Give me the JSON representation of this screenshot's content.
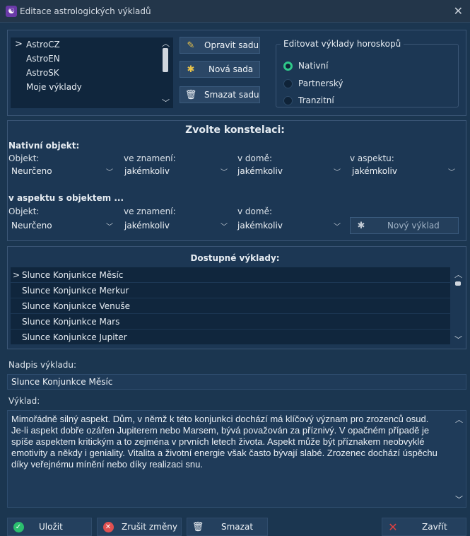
{
  "window": {
    "title": "Editace astrologických výkladů",
    "close_icon": "close-icon"
  },
  "sets": {
    "items": [
      "AstroCZ",
      "AstroEN",
      "AstroSK",
      "Moje výklady"
    ],
    "selected_index": 0
  },
  "set_buttons": {
    "edit": "Opravit sadu",
    "new": "Nová sada",
    "delete": "Smazat sadu"
  },
  "horoscope_group": {
    "legend": "Editovat výklady horoskopů",
    "options": [
      "Nativní",
      "Partnerský",
      "Tranzitní"
    ],
    "selected": "Nativní"
  },
  "constellation": {
    "title": "Zvolte konstelaci:",
    "native_header": "Nativní objekt:",
    "labels": {
      "object": "Objekt:",
      "sign": "ve znamení:",
      "house": "v domě:",
      "aspect": "v aspektu:"
    },
    "row1": {
      "object": "Neurčeno",
      "sign": "jakémkoliv",
      "house": "jakémkoliv",
      "aspect": "jakémkoliv"
    },
    "aspect_header": "v aspektu s objektem ...",
    "row2": {
      "object": "Neurčeno",
      "sign": "jakémkoliv",
      "house": "jakémkoliv"
    },
    "new_interpretation": "Nový výklad"
  },
  "available": {
    "title": "Dostupné výklady:",
    "items": [
      "Slunce Konjunkce Měsíc",
      "Slunce Konjunkce Merkur",
      "Slunce Konjunkce Venuše",
      "Slunce Konjunkce Mars",
      "Slunce Konjunkce Jupiter"
    ]
  },
  "heading": {
    "label": "Nadpis výkladu:",
    "value": "Slunce Konjunkce Měsíc"
  },
  "interpretation": {
    "label": "Výklad:",
    "text": "Mimořádně silný aspekt. Dům, v němž k této konjunkci dochází má klíčový význam pro zrozenců osud. Je-li aspekt dobře ozářen Jupiterem nebo Marsem, bývá považován za příznivý. V opačném případě je spíše aspektem kritickým a to zejména v prvních letech života. Aspekt může být příznakem neobvyklé emotivity a někdy i geniality. Vitalita a životní energie však často bývají slabé. Zrozenec dochází úspěchu díky veřejnému mínění nebo díky realizaci snu."
  },
  "footer": {
    "save": "Uložit",
    "discard": "Zrušit změny",
    "delete": "Smazat",
    "close": "Zavřít"
  },
  "colors": {
    "background": "#1b3650",
    "list_bg": "#10263d",
    "radio_on": "#2fc98a",
    "close_x": "#e04040"
  }
}
